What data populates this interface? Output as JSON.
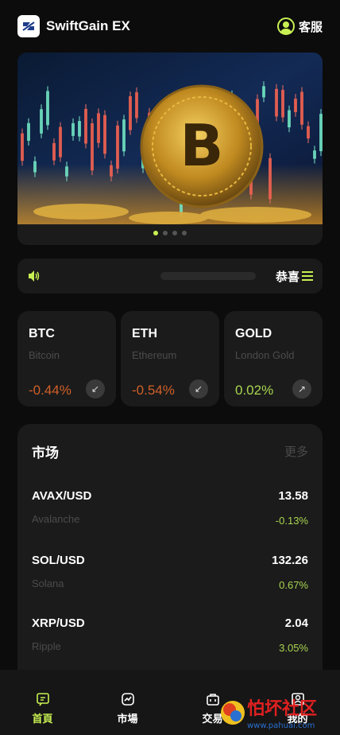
{
  "header": {
    "app_name": "SwiftGain EX",
    "support_label": "客服"
  },
  "banner": {
    "slide_count": 4,
    "active_index": 0
  },
  "notice": {
    "text": "恭喜"
  },
  "featured": [
    {
      "symbol": "BTC",
      "name": "Bitcoin",
      "change": "-0.44%",
      "trend": "down"
    },
    {
      "symbol": "ETH",
      "name": "Ethereum",
      "change": "-0.54%",
      "trend": "down"
    },
    {
      "symbol": "GOLD",
      "name": "London Gold",
      "change": "0.02%",
      "trend": "up"
    }
  ],
  "market": {
    "title": "市场",
    "more_label": "更多",
    "rows": [
      {
        "pair": "AVAX/USD",
        "name": "Avalanche",
        "price": "13.58",
        "change": "-0.13%"
      },
      {
        "pair": "SOL/USD",
        "name": "Solana",
        "price": "132.26",
        "change": "0.67%"
      },
      {
        "pair": "XRP/USD",
        "name": "Ripple",
        "price": "2.04",
        "change": "3.05%"
      }
    ]
  },
  "tabs": [
    {
      "label": "首頁",
      "icon": "home-icon"
    },
    {
      "label": "市場",
      "icon": "market-icon"
    },
    {
      "label": "交易",
      "icon": "trade-icon"
    },
    {
      "label": "我的",
      "icon": "profile-icon"
    }
  ],
  "watermark": {
    "text": "怕坏社区",
    "url": "www.pahuai.com"
  },
  "colors": {
    "accent": "#c8f052",
    "down": "#d06028",
    "up": "#a8d550",
    "background": "#0c0c0c",
    "card": "#1b1b1b"
  }
}
